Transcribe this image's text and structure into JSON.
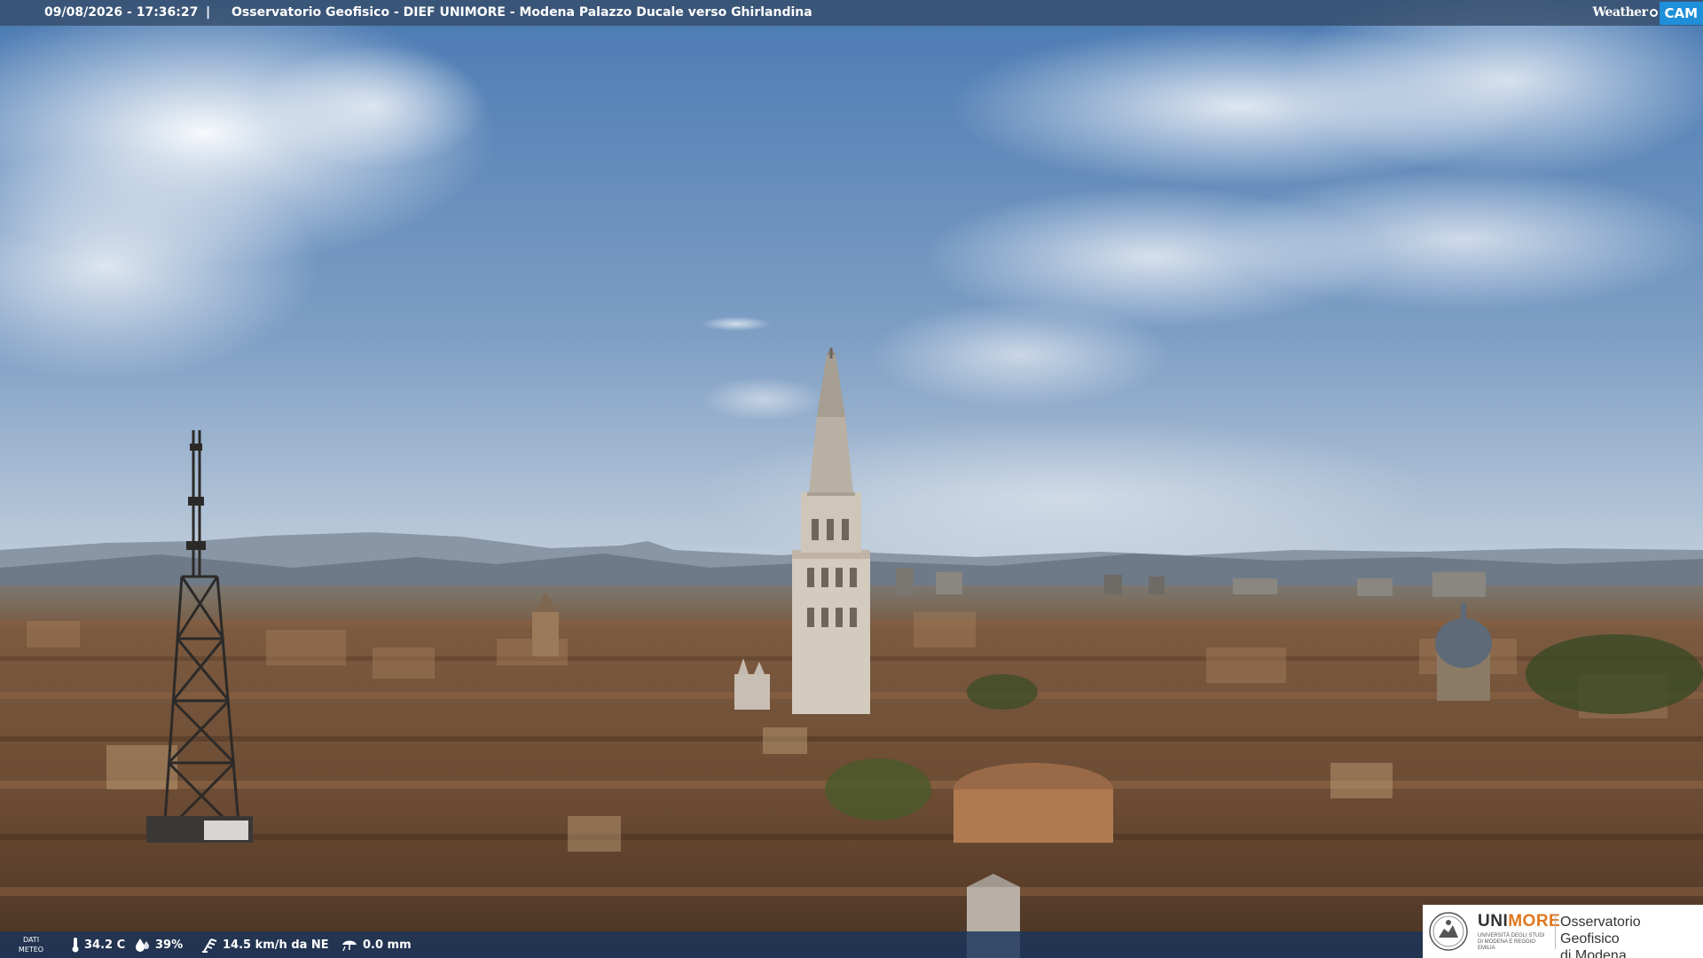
{
  "overlay": {
    "datetime": "09/08/2026 - 17:36:27",
    "separator": "|",
    "caption": "Osservatorio Geofisico - DIEF UNIMORE - Modena Palazzo Ducale verso Ghirlandina"
  },
  "brand": {
    "weather": "Weather",
    "cam": "CAM"
  },
  "weather_bar": {
    "label": "DATI METEO",
    "temperature": "34.2 C",
    "humidity": "39%",
    "wind": "14.5 km/h da NE",
    "rain": "0.0 mm"
  },
  "logo": {
    "uni_prefix": "UNI",
    "uni_highlight": "MORE",
    "uni_sub": "UNIVERSITÀ DEGLI STUDI DI MODENA E REGGIO EMILIA",
    "obs_line1": "Osservatorio Geofisico",
    "obs_line2": "di Modena"
  },
  "colors": {
    "sky_top": "#4f7fb8",
    "sky_horizon": "#dfe4e8",
    "roofs": "#6a4a32",
    "bar": "#1a345c",
    "accent": "#e0781f",
    "cam_badge": "#1e8fd8"
  },
  "icons": [
    "thermometer-icon",
    "humidity-drop-icon",
    "wind-icon",
    "rain-icon",
    "unimore-seal-icon",
    "weathercam-logo"
  ]
}
